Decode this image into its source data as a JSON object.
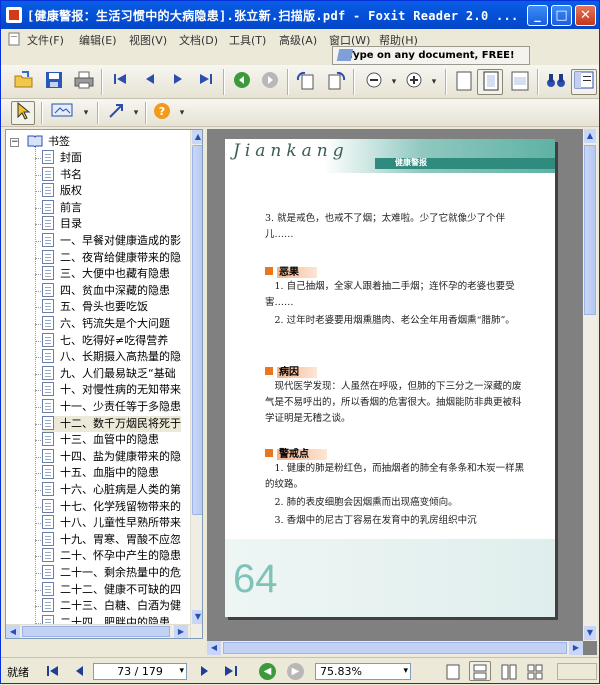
{
  "window": {
    "title": "[健康警报：生活习惯中的大病隐患].张立新.扫描版.pdf - Foxit Reader 2.0 ...",
    "min_label": "_",
    "max_label": "□",
    "close_label": "✕"
  },
  "menu": {
    "items": [
      "文件(F)",
      "编辑(E)",
      "视图(V)",
      "文档(D)",
      "工具(T)",
      "高级(A)",
      "窗口(W)",
      "帮助(H)"
    ]
  },
  "promo": {
    "text": "Type on any document, FREE!"
  },
  "bookmarks": {
    "root_label": "书签",
    "items": [
      "封面",
      "书名",
      "版权",
      "前言",
      "目录",
      "一、早餐对健康造成的影",
      "二、夜宵给健康带来的隐",
      "三、大便中也藏有隐患",
      "四、贫血中深藏的隐患",
      "五、骨头也要吃饭",
      "六、钙流失是个大问题",
      "七、吃得好≠吃得营养",
      "八、长期摄入高热量的隐",
      "九、人们最易缺乏“基础",
      "十、对慢性病的无知带来",
      "十一、少责任等于多隐患",
      "十二、数千万烟民将死于",
      "十三、血管中的隐患",
      "十四、盐为健康带来的隐",
      "十五、血脂中的隐患",
      "十六、心脏病是人类的第",
      "十七、化学残留物带来的",
      "十八、儿童性早熟所带来",
      "十九、胃寒、胃酸不应忽",
      "二十、怀孕中产生的隐患",
      "二十一、剩余热量中的危",
      "二十二、健康不可缺的四",
      "二十三、白糖、白酒为健",
      "二十四、肥胖中的隐患",
      "二十五、神秘毒中的隐患"
    ]
  },
  "page": {
    "header_title": "Jiankang",
    "header_tag": "健康警报",
    "intro": "3. 就是戒色，也戒不了烟；太难啦。少了它就像少了个伴儿……",
    "sections": [
      {
        "title": "恶果",
        "paras": [
          "1. 自己抽烟，全家人跟着抽二手烟；连怀孕的老婆也要受害……",
          "2. 过年时老婆要用烟熏腊肉、老公全年用香烟熏“腊肺”。"
        ]
      },
      {
        "title": "病因",
        "paras": [
          "现代医学发现：人虽然在呼吸，但肺的下三分之一深藏的废气是不易呼出的，所以香烟的危害很大。抽烟能防非典更被科学证明是无稽之谈。"
        ]
      },
      {
        "title": "警戒点",
        "paras": [
          "1. 健康的肺是粉红色，而抽烟者的肺全有条条和木炭一样黑的纹路。",
          "2. 肺的表皮细胞会因烟熏而出现癌变倾向。",
          "3. 香烟中的尼古丁容易在发育中的乳房组织中沉"
        ]
      }
    ],
    "page_number": "64"
  },
  "status": {
    "ready": "就绪",
    "page_field": "73 / 179",
    "zoom": "75.83%"
  }
}
